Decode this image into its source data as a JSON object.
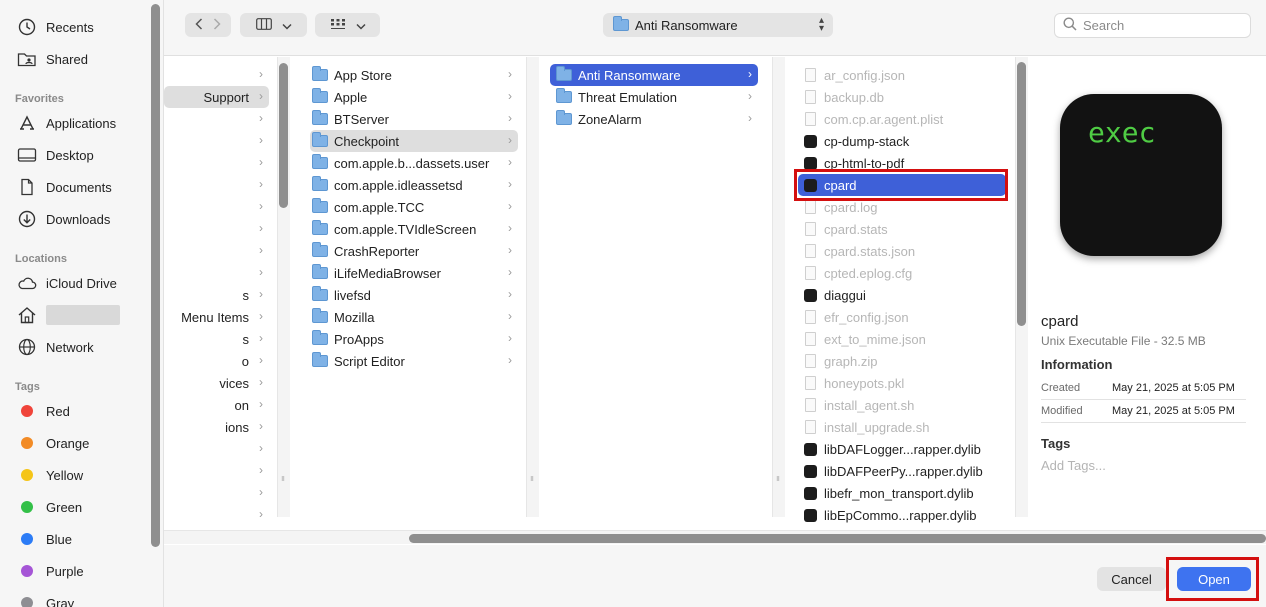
{
  "sidebar": {
    "recents": "Recents",
    "shared": "Shared",
    "favorites_header": "Favorites",
    "favorites": [
      "Applications",
      "Desktop",
      "Documents",
      "Downloads"
    ],
    "locations_header": "Locations",
    "icloud": "iCloud Drive",
    "network": "Network",
    "tags_header": "Tags",
    "tags": [
      {
        "name": "Red",
        "color": "#f0443a"
      },
      {
        "name": "Orange",
        "color": "#f28b26"
      },
      {
        "name": "Yellow",
        "color": "#f5c518"
      },
      {
        "name": "Green",
        "color": "#33c048"
      },
      {
        "name": "Blue",
        "color": "#2c7cf6"
      },
      {
        "name": "Purple",
        "color": "#a555d6"
      },
      {
        "name": "Gray",
        "color": "#8e8e93"
      }
    ]
  },
  "toolbar": {
    "path_label": "Anti Ransomware",
    "search_placeholder": "Search"
  },
  "columns": {
    "col1_fragments": [
      "Support",
      "s",
      "Menu Items",
      "s",
      "o",
      "vices",
      "on",
      "ions"
    ],
    "col2": [
      "App Store",
      "Apple",
      "BTServer",
      "Checkpoint",
      "com.apple.b...dassets.user",
      "com.apple.idleassetsd",
      "com.apple.TCC",
      "com.apple.TVIdleScreen",
      "CrashReporter",
      "iLifeMediaBrowser",
      "livefsd",
      "Mozilla",
      "ProApps",
      "Script Editor"
    ],
    "col3": [
      "Anti Ransomware",
      "Threat Emulation",
      "ZoneAlarm"
    ],
    "col4": [
      {
        "name": "ar_config.json",
        "kind": "doc"
      },
      {
        "name": "backup.db",
        "kind": "doc"
      },
      {
        "name": "com.cp.ar.agent.plist",
        "kind": "doc"
      },
      {
        "name": "cp-dump-stack",
        "kind": "exe"
      },
      {
        "name": "cp-html-to-pdf",
        "kind": "exe"
      },
      {
        "name": "cpard",
        "kind": "exe"
      },
      {
        "name": "cpard.log",
        "kind": "doc"
      },
      {
        "name": "cpard.stats",
        "kind": "doc"
      },
      {
        "name": "cpard.stats.json",
        "kind": "doc"
      },
      {
        "name": "cpted.eplog.cfg",
        "kind": "doc"
      },
      {
        "name": "diaggui",
        "kind": "exe"
      },
      {
        "name": "efr_config.json",
        "kind": "doc"
      },
      {
        "name": "ext_to_mime.json",
        "kind": "doc"
      },
      {
        "name": "graph.zip",
        "kind": "doc"
      },
      {
        "name": "honeypots.pkl",
        "kind": "doc"
      },
      {
        "name": "install_agent.sh",
        "kind": "doc"
      },
      {
        "name": "install_upgrade.sh",
        "kind": "doc"
      },
      {
        "name": "libDAFLogger...rapper.dylib",
        "kind": "exe"
      },
      {
        "name": "libDAFPeerPy...rapper.dylib",
        "kind": "exe"
      },
      {
        "name": "libefr_mon_transport.dylib",
        "kind": "exe"
      },
      {
        "name": "libEpCommo...rapper.dylib",
        "kind": "exe"
      }
    ]
  },
  "preview": {
    "icon_text": "exec",
    "name": "cpard",
    "kind": "Unix Executable File - 32.5 MB",
    "info_header": "Information",
    "created_label": "Created",
    "created_value": "May 21, 2025 at 5:05 PM",
    "modified_label": "Modified",
    "modified_value": "May 21, 2025 at 5:05 PM",
    "tags_header": "Tags",
    "add_tags": "Add Tags..."
  },
  "footer": {
    "cancel": "Cancel",
    "open": "Open"
  }
}
